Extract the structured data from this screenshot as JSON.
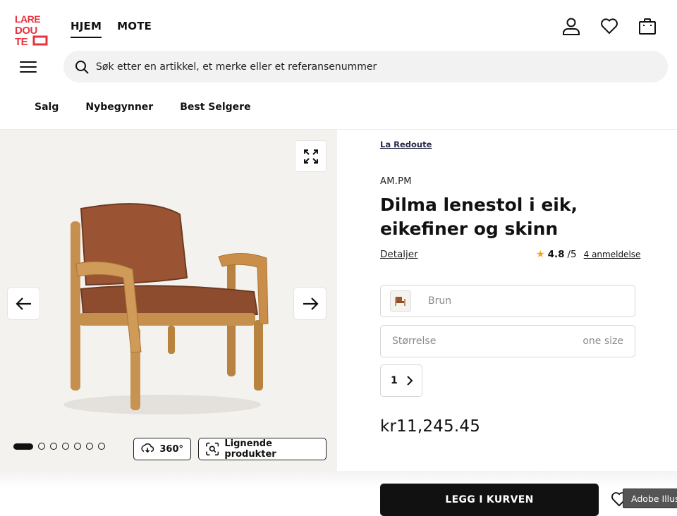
{
  "logo": {
    "lines": [
      "LARE",
      "DOU",
      "TE"
    ],
    "color": "#e8333c"
  },
  "top_nav": [
    {
      "label": "HJEM",
      "active": true
    },
    {
      "label": "MOTE",
      "active": false
    }
  ],
  "header_icons": [
    "user-icon",
    "heart-icon",
    "shopping-bag-icon"
  ],
  "search": {
    "placeholder": "Søk etter en artikkel, et merke eller et referansenummer"
  },
  "category_nav": [
    "Salg",
    "Nybegynner",
    "Best Selgere"
  ],
  "gallery": {
    "slide_count": 7,
    "active_slide": 1,
    "button_360": "360°",
    "button_similar": "Lignende produkter"
  },
  "product": {
    "breadcrumb_brand": "La Redoute",
    "maker": "AM.PM",
    "title": "Dilma lenestol i eik, eikefiner og skinn",
    "details_label": "Detaljer",
    "rating": {
      "score": "4.8",
      "out_of": "/5",
      "reviews_label": "4 anmeldelse"
    },
    "color": {
      "value": "Brun"
    },
    "size": {
      "label": "Størrelse",
      "value": "one size"
    },
    "quantity": "1",
    "price": "kr11,245.45",
    "add_to_cart": "LEGG I KURVEN"
  },
  "tooltip": "Adobe Illustrator",
  "colors": {
    "accent": "#111111",
    "star": "#f3a521",
    "gallery_bg": "#f4f2ef"
  }
}
